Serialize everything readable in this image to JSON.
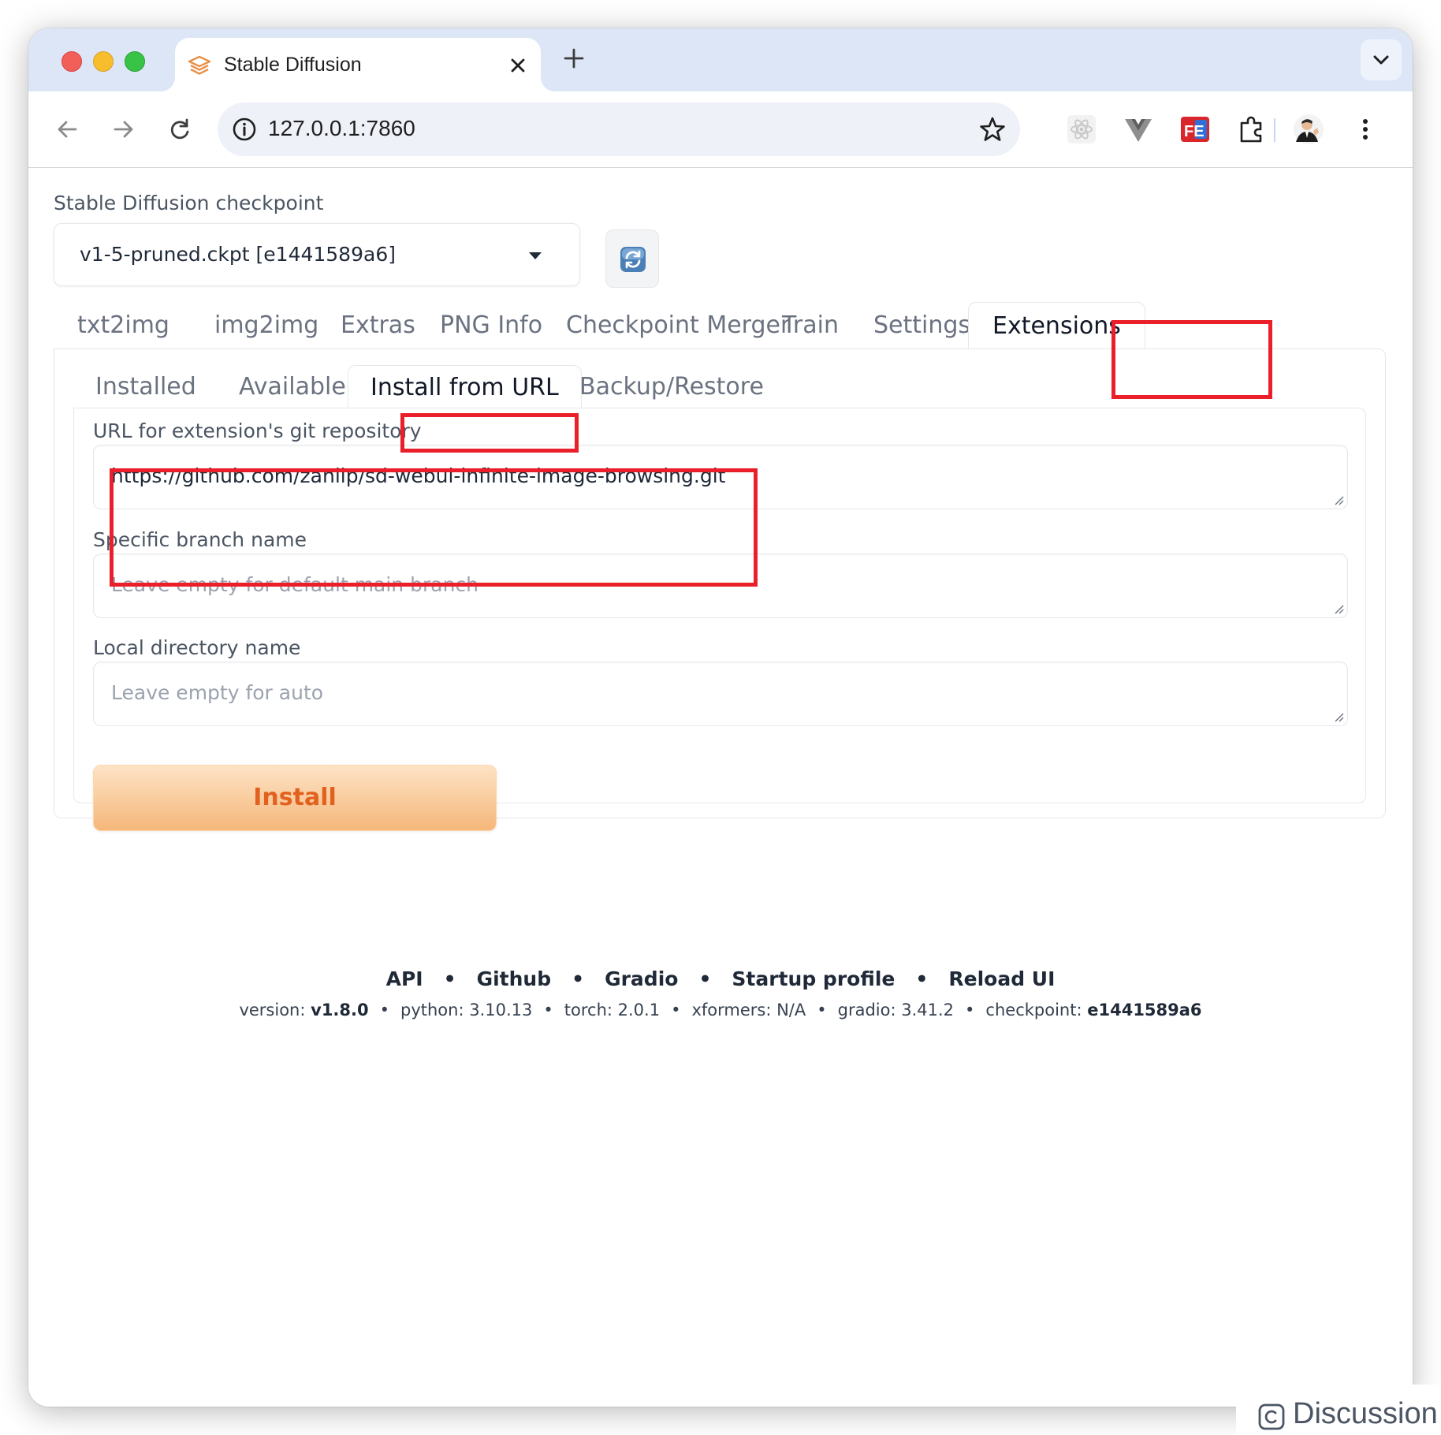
{
  "browser": {
    "tab_title": "Stable Diffusion",
    "url": "127.0.0.1:7860"
  },
  "checkpoint": {
    "label": "Stable Diffusion checkpoint",
    "value": "v1-5-pruned.ckpt [e1441589a6]"
  },
  "main_tabs": [
    "txt2img",
    "img2img",
    "Extras",
    "PNG Info",
    "Checkpoint Merger",
    "Train",
    "Settings",
    "Extensions"
  ],
  "sub_tabs": [
    "Installed",
    "Available",
    "Install from URL",
    "Backup/Restore"
  ],
  "form": {
    "url_label": "URL for extension's git repository",
    "url_value": "https://github.com/zanllp/sd-webui-infinite-image-browsing.git",
    "branch_label": "Specific branch name",
    "branch_placeholder": "Leave empty for default main branch",
    "dir_label": "Local directory name",
    "dir_placeholder": "Leave empty for auto",
    "install_label": "Install"
  },
  "footer": {
    "links": [
      "API",
      "Github",
      "Gradio",
      "Startup profile",
      "Reload UI"
    ],
    "version_label": "version:",
    "version": "v1.8.0",
    "python": "python: 3.10.13",
    "torch": "torch: 2.0.1",
    "xformers": "xformers: N/A",
    "gradio": "gradio: 3.41.2",
    "checkpoint_label": "checkpoint:",
    "checkpoint": "e1441589a6",
    "separator": "•"
  },
  "discussion_label": "Discussion",
  "colors": {
    "accent_orange": "#e2611f",
    "annotation_red": "#ea1f29",
    "tabstrip": "#dde6f7"
  }
}
